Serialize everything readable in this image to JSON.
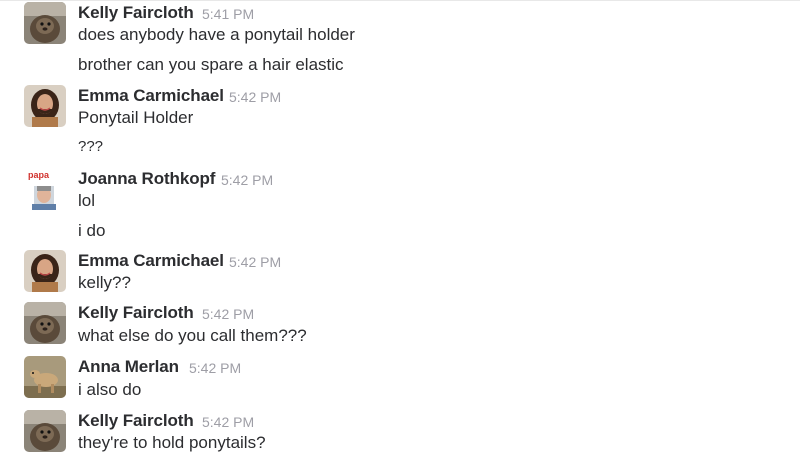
{
  "messages": [
    {
      "avatar": "groundhog-avatar-icon",
      "name": "Kelly Faircloth",
      "time": "5:41 PM",
      "lines": [
        "does anybody have a ponytail holder",
        "brother can you spare a hair elastic"
      ]
    },
    {
      "avatar": "woman-portrait-avatar-icon",
      "name": "Emma Carmichael",
      "time": "5:42 PM",
      "lines": [
        "Ponytail Holder",
        "???"
      ]
    },
    {
      "avatar": "papa-man-avatar-icon",
      "name": "Joanna Rothkopf",
      "time": "5:42 PM",
      "lines": [
        "lol",
        "i do"
      ]
    },
    {
      "avatar": "woman-portrait-avatar-icon",
      "name": "Emma Carmichael",
      "time": "5:42 PM",
      "lines": [
        "kelly??"
      ]
    },
    {
      "avatar": "groundhog-avatar-icon",
      "name": "Kelly Faircloth",
      "time": "5:42 PM",
      "lines": [
        "what else do you call them???"
      ]
    },
    {
      "avatar": "dog-avatar-icon",
      "name": "Anna Merlan",
      "time": "5:42 PM",
      "lines": [
        "i also do"
      ]
    },
    {
      "avatar": "groundhog-avatar-icon",
      "name": "Kelly Faircloth",
      "time": "5:42 PM",
      "lines": [
        "they're to hold ponytails?"
      ]
    }
  ],
  "avatar_label": "papa"
}
